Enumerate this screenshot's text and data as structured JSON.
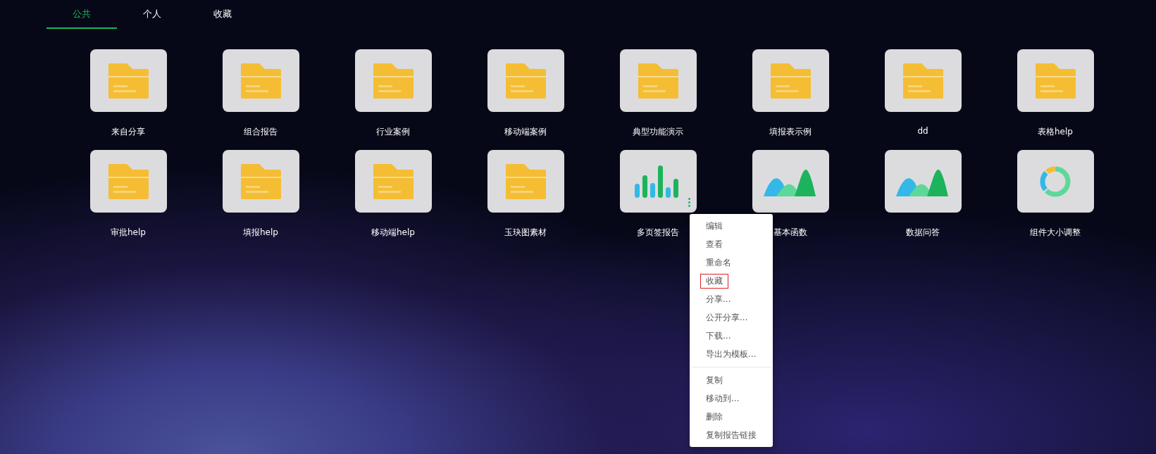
{
  "tabs": [
    {
      "label": "公共",
      "selected": true
    },
    {
      "label": "个人",
      "selected": false
    },
    {
      "label": "收藏",
      "selected": false
    }
  ],
  "items": [
    {
      "name": "来自分享",
      "kind": "folder",
      "menu_open": false
    },
    {
      "name": "组合报告",
      "kind": "folder",
      "menu_open": false
    },
    {
      "name": "行业案例",
      "kind": "folder",
      "menu_open": false
    },
    {
      "name": "移动端案例",
      "kind": "folder",
      "menu_open": false
    },
    {
      "name": "典型功能演示",
      "kind": "folder",
      "menu_open": false
    },
    {
      "name": "填报表示例",
      "kind": "folder",
      "menu_open": false
    },
    {
      "name": "dd",
      "kind": "folder",
      "menu_open": false
    },
    {
      "name": "表格help",
      "kind": "folder",
      "menu_open": false
    },
    {
      "name": "审批help",
      "kind": "folder",
      "menu_open": false
    },
    {
      "name": "填报help",
      "kind": "folder",
      "menu_open": false
    },
    {
      "name": "移动端help",
      "kind": "folder",
      "menu_open": false
    },
    {
      "name": "玉玦图素材",
      "kind": "folder",
      "menu_open": false
    },
    {
      "name": "多页签报告",
      "kind": "bar-chart",
      "menu_open": true
    },
    {
      "name": "基本函数",
      "kind": "area-chart",
      "menu_open": false
    },
    {
      "name": "数据问答",
      "kind": "area-chart",
      "menu_open": false
    },
    {
      "name": "组件大小调整",
      "kind": "donut-chart",
      "menu_open": false
    }
  ],
  "context_menu": {
    "groups": [
      [
        {
          "label": "编辑",
          "highlighted": false
        },
        {
          "label": "查看",
          "highlighted": false
        },
        {
          "label": "重命名",
          "highlighted": false
        },
        {
          "label": "收藏",
          "highlighted": true
        },
        {
          "label": "分享...",
          "highlighted": false
        },
        {
          "label": "公开分享...",
          "highlighted": false
        },
        {
          "label": "下载...",
          "highlighted": false
        },
        {
          "label": "导出为模板...",
          "highlighted": false
        }
      ],
      [
        {
          "label": "复制",
          "highlighted": false
        },
        {
          "label": "移动到...",
          "highlighted": false
        },
        {
          "label": "删除",
          "highlighted": false
        },
        {
          "label": "复制报告链接",
          "highlighted": false
        }
      ]
    ]
  }
}
